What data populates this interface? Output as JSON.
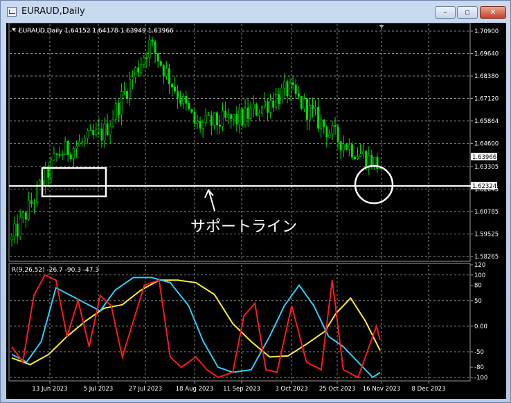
{
  "window": {
    "title": "EURAUD,Daily",
    "buttons": {
      "minimize": "–",
      "maximize": "▫",
      "close": "✕"
    }
  },
  "main_chart": {
    "header": "EURAUD,Daily  1.64152 1.64178 1.63949 1.63966",
    "price_labels": [
      "1.70900",
      "1.69640",
      "1.68380",
      "1.67120",
      "1.65864",
      "1.64600",
      "1.63305",
      "1.62045",
      "1.60785",
      "1.59525",
      "1.58265"
    ],
    "current_price": "1.63966",
    "support_price": "1.62324",
    "annotation": "サポートライン",
    "colors": {
      "candle": "#00e000",
      "grid": "#bfbfbf",
      "support": "#ffffff"
    }
  },
  "indicator": {
    "header": "R(9,26,52) -26.7 -90.3 -47.3",
    "labels": [
      "120",
      "100",
      "80",
      "50",
      "0.00",
      "-50",
      "-80",
      "-100"
    ],
    "colors": {
      "fast": "#ff1a1a",
      "mid": "#33ccff",
      "slow": "#ffee33"
    }
  },
  "date_labels": [
    "13 Jun 2023",
    "5 Jul 2023",
    "27 Jul 2023",
    "18 Aug 2023",
    "11 Sep 2023",
    "3 Oct 2023",
    "25 Oct 2023",
    "16 Nov 2023",
    "8 Dec 2023"
  ],
  "chart_data": {
    "type": "line",
    "title": "EURAUD,Daily",
    "x": [
      "13 Jun 2023",
      "5 Jul 2023",
      "27 Jul 2023",
      "18 Aug 2023",
      "11 Sep 2023",
      "3 Oct 2023",
      "25 Oct 2023",
      "16 Nov 2023",
      "8 Dec 2023"
    ],
    "ylim": [
      1.58265,
      1.709
    ],
    "series": [
      {
        "name": "price",
        "values": [
          1.592,
          1.64,
          1.652,
          1.702,
          1.656,
          1.66,
          1.676,
          1.65,
          1.633
        ]
      }
    ],
    "support_level": 1.62324,
    "oscillator": {
      "label": "R(9,26,52)",
      "ylim": [
        -100,
        120
      ],
      "last_values": [
        -26.7,
        -90.3,
        -47.3
      ]
    }
  }
}
